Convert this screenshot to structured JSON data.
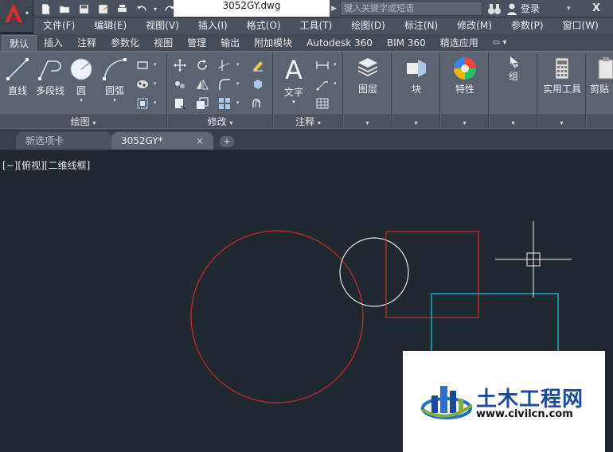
{
  "title_bar": {
    "document_title": "3052GY.dwg",
    "search_placeholder": "键入关键字或短语",
    "login_label": "登录",
    "exchange_label": "X"
  },
  "menu": [
    "文件(F)",
    "编辑(E)",
    "视图(V)",
    "插入(I)",
    "格式(O)",
    "工具(T)",
    "绘图(D)",
    "标注(N)",
    "修改(M)",
    "参数(P)",
    "窗口(W)"
  ],
  "ribbon_tabs": {
    "items": [
      "默认",
      "插入",
      "注释",
      "参数化",
      "视图",
      "管理",
      "输出",
      "附加模块",
      "Autodesk 360",
      "BIM 360",
      "精选应用"
    ],
    "active": "默认"
  },
  "ribbon": {
    "draw": {
      "panel_label": "绘图",
      "line": "直线",
      "polyline": "多段线",
      "circle": "圆",
      "arc": "圆弧"
    },
    "modify": {
      "panel_label": "修改"
    },
    "annotation": {
      "panel_label": "注释",
      "text": "文字"
    },
    "layers": {
      "label": "图层"
    },
    "block": {
      "label": "块"
    },
    "properties": {
      "label": "特性"
    },
    "groups": {
      "label": "组"
    },
    "utilities": {
      "label": "实用工具"
    },
    "clipboard": {
      "label": "剪贴"
    }
  },
  "file_tabs": {
    "new_tab": "新选项卡",
    "current": "3052GY*",
    "close": "×",
    "add": "+"
  },
  "viewport": {
    "label": "[−][俯视][二维线框]"
  },
  "colors": {
    "red_geometry": "#c8282b",
    "white_geometry": "#e6e6e6",
    "cyan_geometry": "#1fc6d6",
    "background": "#212830"
  },
  "watermark": {
    "name": "土木工程网",
    "url": "www.civilcn.com"
  }
}
